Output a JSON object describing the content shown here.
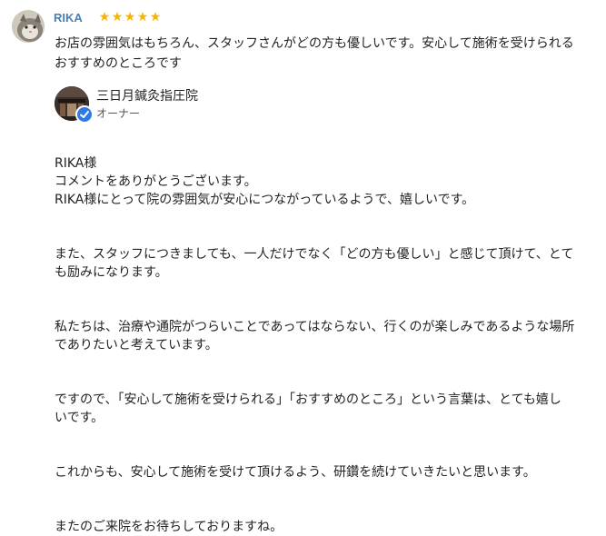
{
  "review": {
    "reviewer_name": "RIKA",
    "rating": 5,
    "star_glyph": "★",
    "star_color": "#f5b400",
    "text_lines": [
      "お店の雰囲気はもちろん、スタッフさんがどの方も優しいです。安心して施術を受けられる",
      "おすすめのところです"
    ]
  },
  "owner": {
    "name": "三日月鍼灸指圧院",
    "role": "オーナー",
    "verified_color": "#2f7ae5"
  },
  "reply": {
    "salutation": "RIKA様",
    "paragraphs": [
      [
        "コメントをありがとうございます。",
        "RIKA様にとって院の雰囲気が安心につながっているようで、嬉しいです。"
      ],
      [
        "また、スタッフにつきましても、一人だけでなく「どの方も優しい」と感じて頂けて、とて",
        "も励みになります。"
      ],
      [
        "私たちは、治療や通院がつらいことであってはならない、行くのが楽しみであるような場所",
        "でありたいと考えています。"
      ],
      [
        "ですので、「安心して施術を受けられる」「おすすめのところ」という言葉は、とても嬉し",
        "いです。"
      ],
      [
        "これからも、安心して施術を受けて頂けるよう、研鑽を続けていきたいと思います。"
      ],
      [
        "またのご来院をお待ちしておりますね。"
      ]
    ]
  }
}
